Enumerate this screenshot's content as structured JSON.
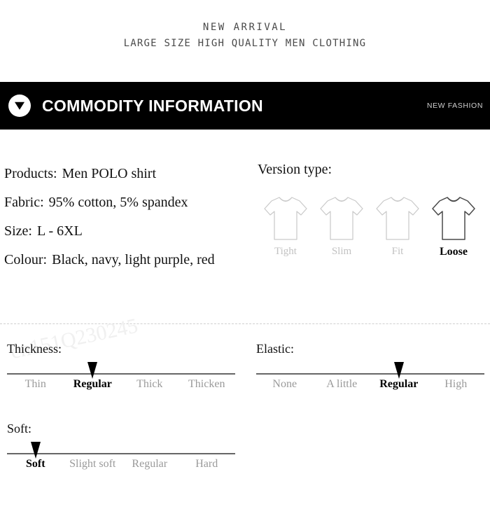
{
  "top_heading": {
    "line1": "NEW ARRIVAL",
    "line2": "LARGE SIZE HIGH QUALITY MEN CLOTHING"
  },
  "banner": {
    "badge_icon": "triangle-down-icon",
    "title": "COMMODITY INFORMATION",
    "right_label": "NEW FASHION",
    "background_color": "#000000",
    "text_color": "#ffffff"
  },
  "specs": [
    {
      "key": "Products:",
      "value": "Men POLO shirt"
    },
    {
      "key": "Fabric:",
      "value": "95% cotton, 5% spandex"
    },
    {
      "key": "Size:",
      "value": "L - 6XL"
    },
    {
      "key": "Colour:",
      "value": "Black, navy, light purple, red"
    }
  ],
  "version_type": {
    "title": "Version type:",
    "options": [
      {
        "label": "Tight",
        "selected": false
      },
      {
        "label": "Slim",
        "selected": false
      },
      {
        "label": "Fit",
        "selected": false
      },
      {
        "label": "Loose",
        "selected": true
      }
    ],
    "selected_color": "#000000",
    "unselected_color": "#c2c2c2"
  },
  "watermark": "cn151Q230245",
  "scales": [
    {
      "title": "Thickness:",
      "labels": [
        "Thin",
        "Regular",
        "Thick",
        "Thicken"
      ],
      "selected_index": 1
    },
    {
      "title": "Elastic:",
      "labels": [
        "None",
        "A little",
        "Regular",
        "High"
      ],
      "selected_index": 2
    },
    {
      "title": "Soft:",
      "labels": [
        "Soft",
        "Slight soft",
        "Regular",
        "Hard"
      ],
      "selected_index": 0
    }
  ]
}
